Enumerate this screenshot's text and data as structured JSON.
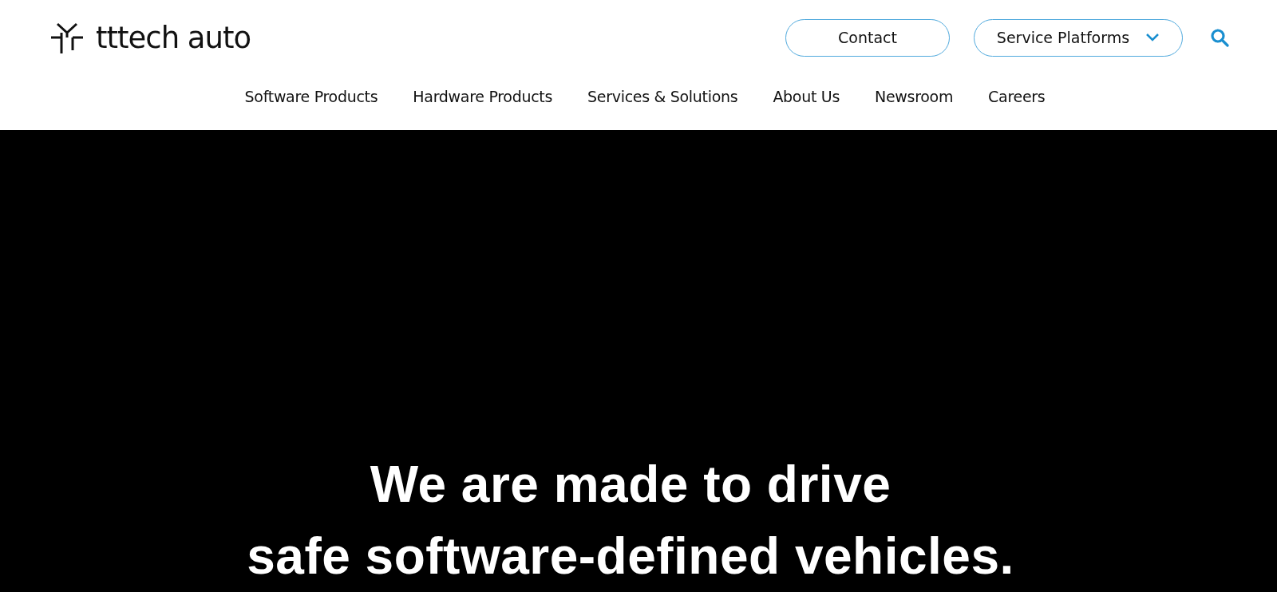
{
  "header": {
    "logo": "tttech auto",
    "contact_button": "Contact",
    "platforms_dropdown": "Service Platforms"
  },
  "nav": [
    "Software Products",
    "Hardware Products",
    "Services & Solutions",
    "About Us",
    "Newsroom",
    "Careers"
  ],
  "hero": {
    "headline": [
      "We are made to drive",
      "safe software-defined vehicles."
    ]
  }
}
